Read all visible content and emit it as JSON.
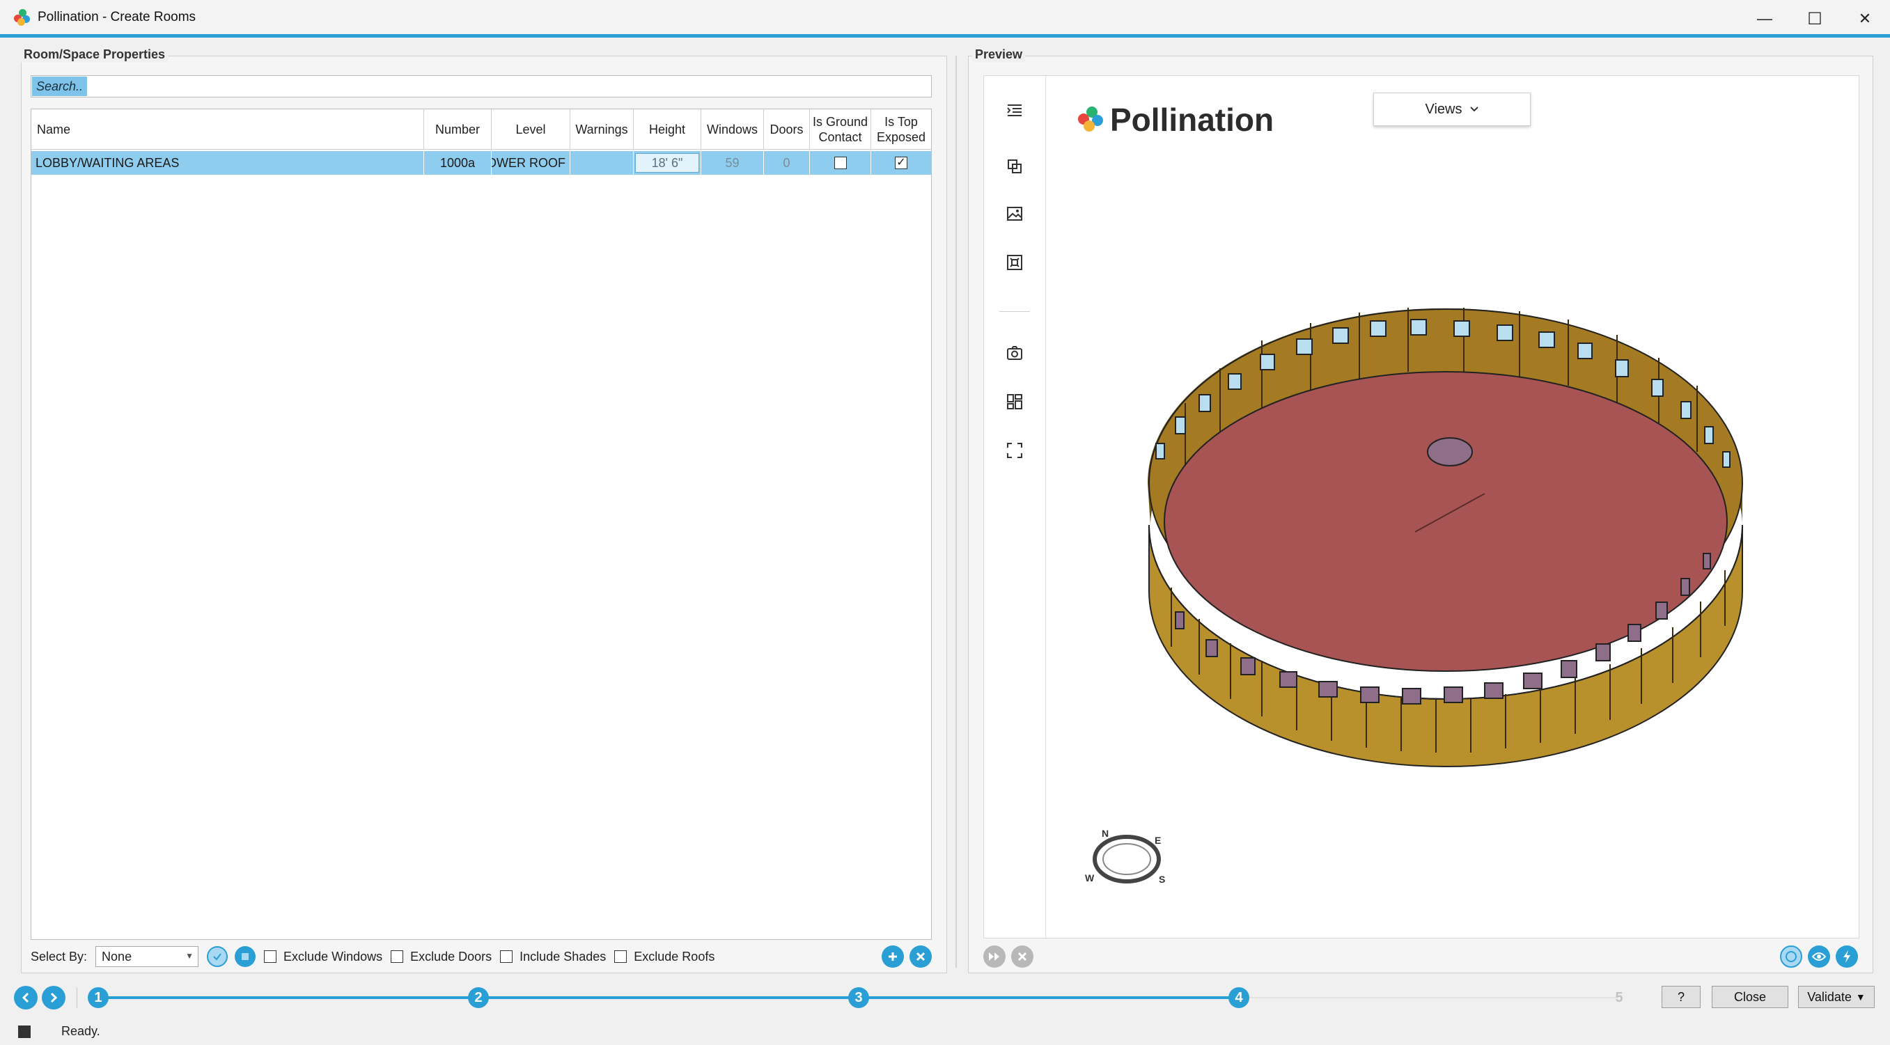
{
  "window": {
    "title": "Pollination - Create Rooms",
    "minimize": "—",
    "maximize": "☐",
    "close": "✕"
  },
  "left_panel": {
    "title": "Room/Space Properties",
    "search_placeholder": "Search..",
    "columns": [
      "Name",
      "Number",
      "Level",
      "Warnings",
      "Height",
      "Windows",
      "Doors",
      "Is Ground Contact",
      "Is Top Exposed"
    ],
    "rows": [
      {
        "name": "LOBBY/WAITING AREAS",
        "number": "1000a",
        "level": "LOWER ROOF",
        "warnings": "",
        "height": "18'  6\"",
        "windows": "59",
        "doors": "0",
        "is_ground_contact": false,
        "is_top_exposed": true
      }
    ],
    "select_by_label": "Select By:",
    "select_by_value": "None",
    "exclude_windows": "Exclude Windows",
    "exclude_doors": "Exclude Doors",
    "include_shades": "Include Shades",
    "exclude_roofs": "Exclude Roofs"
  },
  "preview": {
    "title": "Preview",
    "brand": "Pollination",
    "views_button": "Views",
    "compass": {
      "n": "N",
      "e": "E",
      "s": "S",
      "w": "W"
    }
  },
  "wizard": {
    "steps": [
      "1",
      "2",
      "3",
      "4",
      "5"
    ],
    "active_steps": 4,
    "help_button": "?",
    "close_button": "Close",
    "validate_button": "Validate"
  },
  "status": {
    "text": "Ready."
  },
  "colors": {
    "accent": "#2a9fd6",
    "row_selected": "#8fcdee",
    "wall": "#b8902c",
    "floor": "#a85454",
    "window": "#b9def0"
  }
}
